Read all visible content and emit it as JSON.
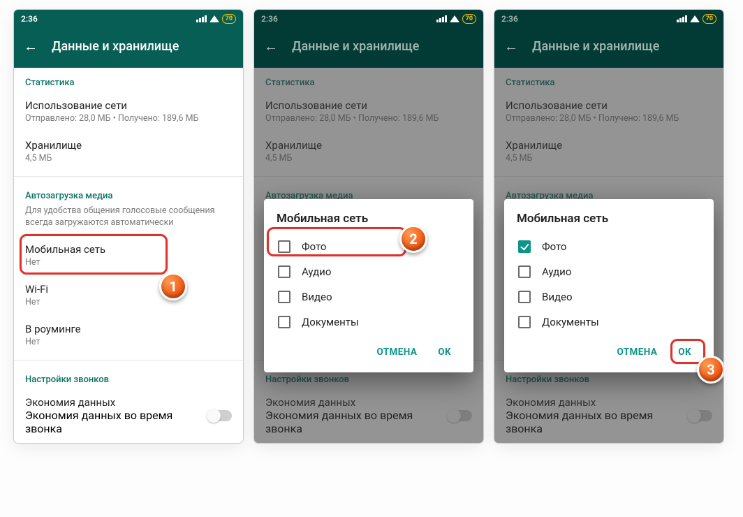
{
  "status": {
    "time": "2:36",
    "battery": "70"
  },
  "appbar": {
    "title": "Данные и хранилище"
  },
  "sections": {
    "stats_label": "Статистика",
    "net_usage": {
      "title": "Использование сети",
      "sub": "Отправлено: 28,0 МБ • Получено: 189,6 МБ"
    },
    "storage": {
      "title": "Хранилище",
      "sub": "4,5 МБ"
    },
    "autodl_label": "Автозагрузка медиа",
    "autodl_hint": "Для удобства общения голосовые сообщения всегда загружаются автоматически",
    "mobile": {
      "title": "Мобильная сеть",
      "sub": "Нет"
    },
    "wifi": {
      "title": "Wi-Fi",
      "sub": "Нет"
    },
    "roaming": {
      "title": "В роуминге",
      "sub": "Нет"
    },
    "calls_label": "Настройки звонков",
    "data_saver": {
      "title": "Экономия данных",
      "sub": "Экономия данных во время звонка"
    }
  },
  "dialog": {
    "title": "Мобильная сеть",
    "options": {
      "photo": "Фото",
      "audio": "Аудио",
      "video": "Видео",
      "docs": "Документы"
    },
    "cancel": "ОТМЕНА",
    "ok": "OK"
  },
  "badges": {
    "b1": "1",
    "b2": "2",
    "b3": "3"
  }
}
